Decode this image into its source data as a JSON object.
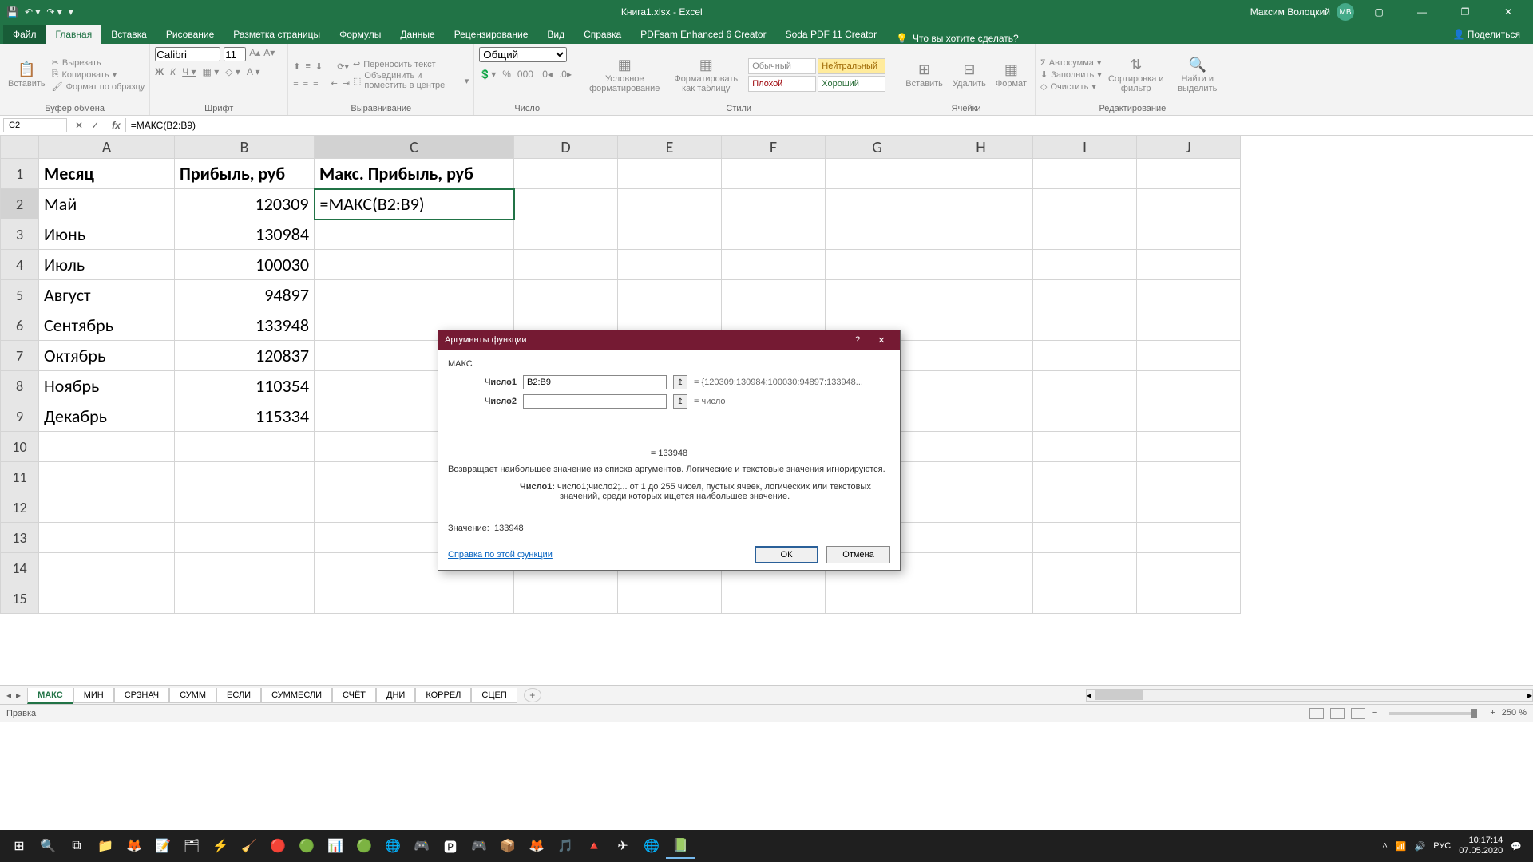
{
  "titlebar": {
    "doc_title": "Книга1.xlsx - Excel",
    "user_name": "Максим Волоцкий",
    "user_initials": "МВ"
  },
  "tabs": {
    "file": "Файл",
    "items": [
      "Главная",
      "Вставка",
      "Рисование",
      "Разметка страницы",
      "Формулы",
      "Данные",
      "Рецензирование",
      "Вид",
      "Справка",
      "PDFsam Enhanced 6 Creator",
      "Soda PDF 11 Creator"
    ],
    "active": 0,
    "tell_me": "Что вы хотите сделать?",
    "share": "Поделиться"
  },
  "ribbon": {
    "clipboard": {
      "label": "Буфер обмена",
      "paste": "Вставить",
      "cut": "Вырезать",
      "copy": "Копировать",
      "format": "Формат по образцу"
    },
    "font": {
      "label": "Шрифт",
      "name": "Calibri",
      "size": "11"
    },
    "align": {
      "label": "Выравнивание",
      "wrap": "Переносить текст",
      "merge": "Объединить и поместить в центре"
    },
    "number": {
      "label": "Число",
      "format": "Общий"
    },
    "styles": {
      "label": "Стили",
      "cond": "Условное форматирование",
      "table": "Форматировать как таблицу",
      "normal": "Обычный",
      "neutral": "Нейтральный",
      "bad": "Плохой",
      "good": "Хороший"
    },
    "cells": {
      "label": "Ячейки",
      "insert": "Вставить",
      "delete": "Удалить",
      "format": "Формат"
    },
    "edit": {
      "label": "Редактирование",
      "sum": "Автосумма",
      "fill": "Заполнить",
      "clear": "Очистить",
      "sort": "Сортировка и фильтр",
      "find": "Найти и выделить"
    }
  },
  "formulabar": {
    "name": "C2",
    "formula": "=МАКС(B2:B9)"
  },
  "columns": [
    "A",
    "B",
    "C",
    "D",
    "E",
    "F",
    "G",
    "H",
    "I",
    "J"
  ],
  "headers": {
    "a": "Месяц",
    "b": "Прибыль, руб",
    "c": "Макс. Прибыль, руб"
  },
  "rows": [
    {
      "a": "Май",
      "b": "120309"
    },
    {
      "a": "Июнь",
      "b": "130984"
    },
    {
      "a": "Июль",
      "b": "100030"
    },
    {
      "a": "Август",
      "b": "94897"
    },
    {
      "a": "Сентябрь",
      "b": "133948"
    },
    {
      "a": "Октябрь",
      "b": "120837"
    },
    {
      "a": "Ноябрь",
      "b": "110354"
    },
    {
      "a": "Декабрь",
      "b": "115334"
    }
  ],
  "active_cell_display": "=МАКС(B2:B9)",
  "sheets": [
    "МАКС",
    "МИН",
    "СРЗНАЧ",
    "СУММ",
    "ЕСЛИ",
    "СУММЕСЛИ",
    "СЧЁТ",
    "ДНИ",
    "КОРРЕЛ",
    "СЦЕП"
  ],
  "active_sheet": 0,
  "status": {
    "mode": "Правка",
    "zoom": "250 %"
  },
  "dialog": {
    "title": "Аргументы функции",
    "func": "МАКС",
    "arg1_label": "Число1",
    "arg1_value": "B2:B9",
    "arg1_result": "= {120309:130984:100030:94897:133948...",
    "arg2_label": "Число2",
    "arg2_result": "= число",
    "result_line": "= 133948",
    "desc": "Возвращает наибольшее значение из списка аргументов. Логические и текстовые значения игнорируются.",
    "param_label": "Число1:",
    "param_desc": "число1;число2;... от 1 до 255 чисел, пустых ячеек, логических или текстовых значений, среди которых ищется наибольшее значение.",
    "value_label": "Значение:",
    "value": "133948",
    "help": "Справка по этой функции",
    "ok": "ОК",
    "cancel": "Отмена"
  },
  "taskbar": {
    "lang": "РУС",
    "time": "10:17:14",
    "date": "07.05.2020"
  }
}
